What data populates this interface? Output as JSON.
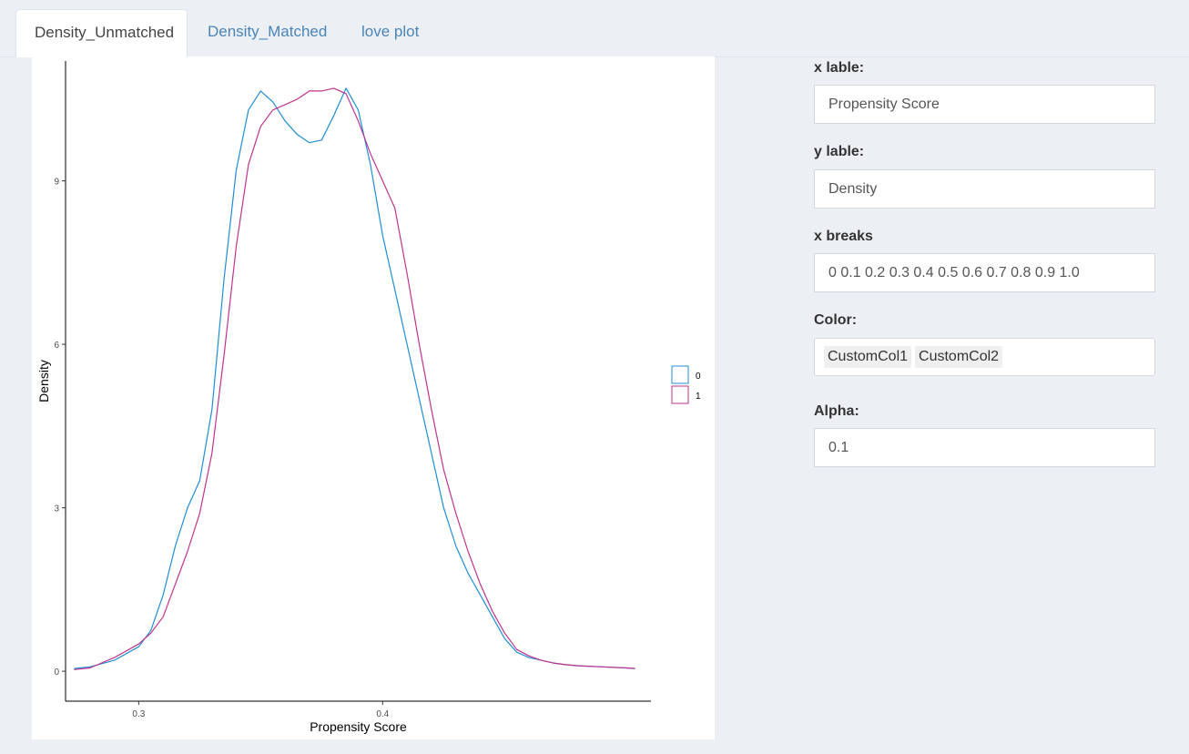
{
  "tabs": [
    {
      "label": "Density_Unmatched",
      "active": true
    },
    {
      "label": "Density_Matched",
      "active": false
    },
    {
      "label": "love plot",
      "active": false
    }
  ],
  "controls": {
    "x_label": {
      "label": "x lable:",
      "value": "Propensity Score"
    },
    "y_label": {
      "label": "y lable:",
      "value": "Density"
    },
    "x_breaks": {
      "label": "x breaks",
      "value": "0 0.1 0.2 0.3 0.4 0.5 0.6 0.7 0.8 0.9 1.0"
    },
    "color": {
      "label": "Color:",
      "selected": [
        "CustomCol1",
        "CustomCol2"
      ]
    },
    "alpha": {
      "label": "Alpha:",
      "value": "0.1"
    }
  },
  "colors": {
    "series0": "#1f8ed6",
    "series1": "#c0338f"
  },
  "chart_data": {
    "type": "line",
    "title": "",
    "xlabel": "Propensity Score",
    "ylabel": "Density",
    "xlim": [
      0.27,
      0.51
    ],
    "ylim": [
      -0.55,
      11.2
    ],
    "xticks": [
      0.3,
      0.4
    ],
    "yticks": [
      0,
      3,
      6,
      9
    ],
    "grid": false,
    "legend": {
      "position": "right",
      "entries": [
        "0",
        "1"
      ]
    },
    "series": [
      {
        "name": "0",
        "color": "#1f8ed6",
        "x": [
          0.2735,
          0.28,
          0.29,
          0.3,
          0.305,
          0.31,
          0.315,
          0.32,
          0.325,
          0.33,
          0.335,
          0.34,
          0.345,
          0.35,
          0.355,
          0.36,
          0.365,
          0.37,
          0.375,
          0.38,
          0.385,
          0.39,
          0.395,
          0.4,
          0.405,
          0.41,
          0.415,
          0.42,
          0.425,
          0.43,
          0.435,
          0.44,
          0.445,
          0.45,
          0.455,
          0.46,
          0.465,
          0.47,
          0.475,
          0.48,
          0.49,
          0.5,
          0.5035
        ],
        "y": [
          0.05,
          0.08,
          0.2,
          0.45,
          0.75,
          1.4,
          2.3,
          3.0,
          3.5,
          4.8,
          7.2,
          9.2,
          10.3,
          10.65,
          10.45,
          10.1,
          9.85,
          9.7,
          9.75,
          10.2,
          10.7,
          10.3,
          9.3,
          8.0,
          7.0,
          6.0,
          5.0,
          4.0,
          3.0,
          2.3,
          1.8,
          1.4,
          1.0,
          0.6,
          0.35,
          0.25,
          0.2,
          0.15,
          0.12,
          0.1,
          0.08,
          0.06,
          0.05
        ]
      },
      {
        "name": "1",
        "color": "#c0338f",
        "x": [
          0.2735,
          0.28,
          0.29,
          0.3,
          0.305,
          0.31,
          0.315,
          0.32,
          0.325,
          0.33,
          0.335,
          0.34,
          0.345,
          0.35,
          0.355,
          0.36,
          0.365,
          0.37,
          0.375,
          0.38,
          0.385,
          0.39,
          0.395,
          0.4,
          0.405,
          0.41,
          0.415,
          0.42,
          0.425,
          0.43,
          0.435,
          0.44,
          0.445,
          0.45,
          0.455,
          0.46,
          0.465,
          0.47,
          0.475,
          0.48,
          0.49,
          0.5,
          0.5035
        ],
        "y": [
          0.03,
          0.06,
          0.25,
          0.5,
          0.7,
          1.0,
          1.6,
          2.2,
          2.9,
          4.0,
          5.8,
          7.8,
          9.3,
          10.0,
          10.3,
          10.4,
          10.5,
          10.65,
          10.65,
          10.7,
          10.6,
          10.1,
          9.5,
          9.0,
          8.5,
          7.3,
          6.0,
          4.8,
          3.7,
          2.9,
          2.2,
          1.6,
          1.1,
          0.7,
          0.4,
          0.28,
          0.2,
          0.15,
          0.12,
          0.1,
          0.08,
          0.06,
          0.05
        ]
      }
    ]
  }
}
